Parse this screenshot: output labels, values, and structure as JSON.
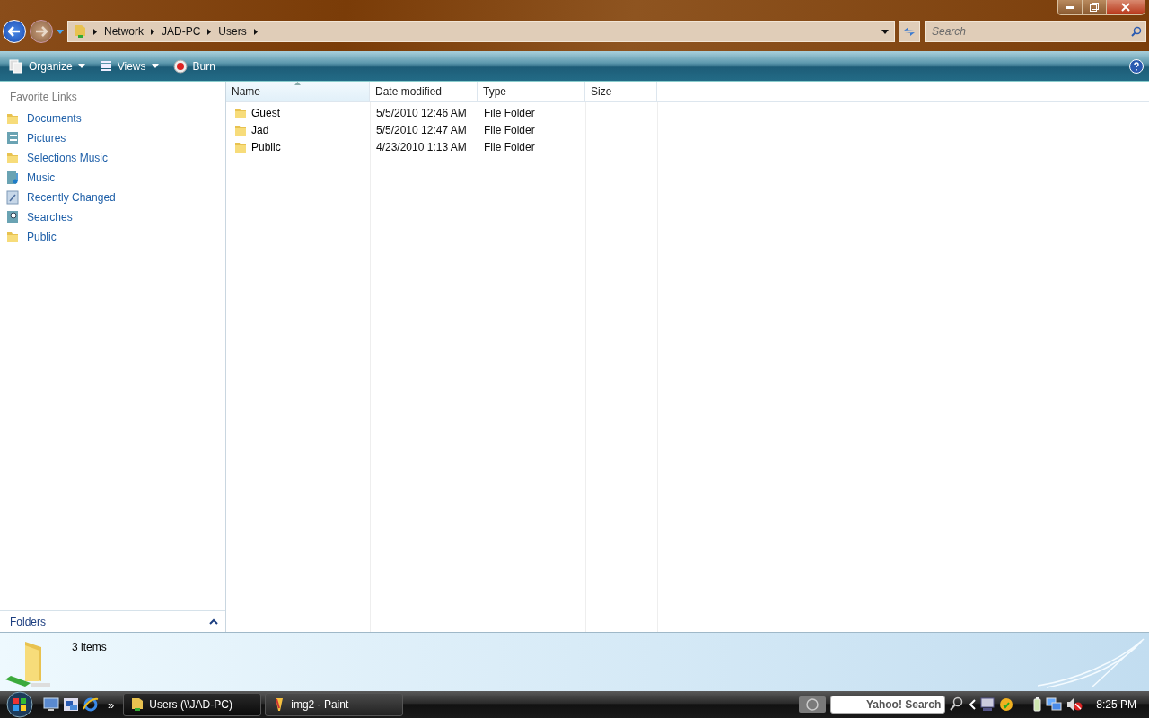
{
  "address_bar": {
    "crumbs": [
      "Network",
      "JAD-PC",
      "Users"
    ]
  },
  "search": {
    "placeholder": "Search"
  },
  "toolbar": {
    "buttons": [
      {
        "label": "Organize",
        "kind": "menu"
      },
      {
        "label": "Views",
        "kind": "menu"
      },
      {
        "label": "Burn",
        "kind": "plain"
      }
    ]
  },
  "sidebar": {
    "title": "Favorite Links",
    "items": [
      {
        "label": "Documents",
        "kind": "folder"
      },
      {
        "label": "Pictures",
        "kind": "library"
      },
      {
        "label": "Selections Music",
        "kind": "folder"
      },
      {
        "label": "Music",
        "kind": "music"
      },
      {
        "label": "Recently Changed",
        "kind": "recent"
      },
      {
        "label": "Searches",
        "kind": "search"
      },
      {
        "label": "Public",
        "kind": "folder"
      }
    ],
    "folders_label": "Folders",
    "folders_expanded": false
  },
  "table": {
    "columns": [
      {
        "label": "Name",
        "sorted": true
      },
      {
        "label": "Date modified",
        "sorted": false
      },
      {
        "label": "Type",
        "sorted": false
      },
      {
        "label": "Size",
        "sorted": false
      }
    ],
    "rows": [
      {
        "name": "Guest",
        "date": "5/5/2010 12:46 AM",
        "type": "File Folder"
      },
      {
        "name": "Jad",
        "date": "5/5/2010 12:47 AM",
        "type": "File Folder"
      },
      {
        "name": "Public",
        "date": "4/23/2010 1:13 AM",
        "type": "File Folder"
      }
    ]
  },
  "details": {
    "count": "3 items"
  },
  "taskbar": {
    "more": "»",
    "tasks": [
      {
        "label": "Users (\\\\JAD-PC)",
        "selected": true,
        "kind": "explorer"
      },
      {
        "label": "img2 - Paint",
        "selected": false,
        "kind": "paint"
      }
    ],
    "search_value": "Yahoo! Search",
    "clock": "8:25 PM"
  }
}
